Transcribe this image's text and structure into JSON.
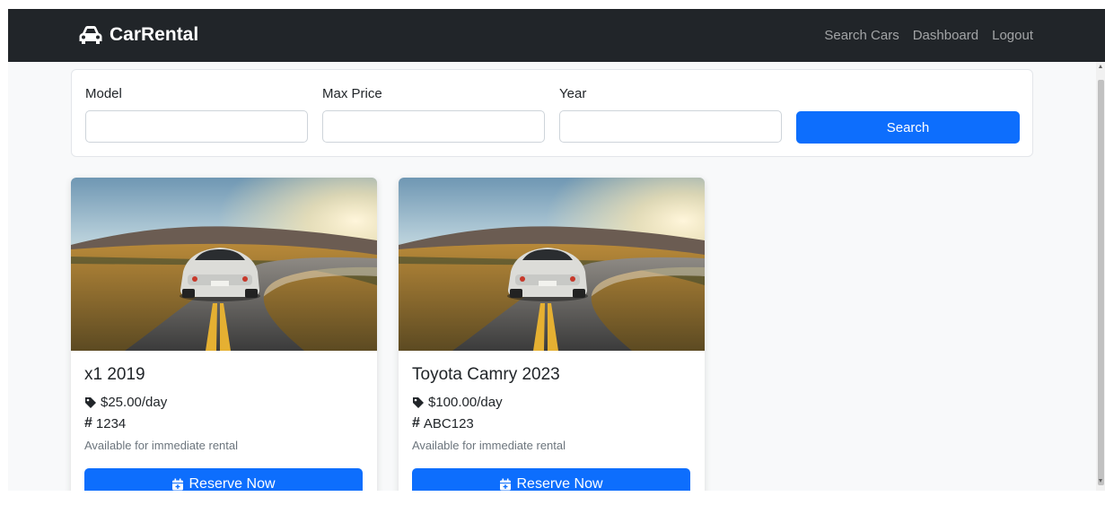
{
  "nav": {
    "brand": "CarRental",
    "links": [
      "Search Cars",
      "Dashboard",
      "Logout"
    ]
  },
  "search": {
    "fields": [
      {
        "label": "Model",
        "value": "",
        "placeholder": ""
      },
      {
        "label": "Max Price",
        "value": "",
        "placeholder": ""
      },
      {
        "label": "Year",
        "value": "",
        "placeholder": ""
      }
    ],
    "button": "Search"
  },
  "cars": [
    {
      "title": "x1 2019",
      "price": "$25.00/day",
      "plate": "1234",
      "availability": "Available for immediate rental",
      "button": "Reserve Now"
    },
    {
      "title": "Toyota Camry 2023",
      "price": "$100.00/day",
      "plate": "ABC123",
      "availability": "Available for immediate rental",
      "button": "Reserve Now"
    }
  ],
  "colors": {
    "navbar": "#212529",
    "primary": "#0d6efd",
    "page": "#f8f9fa",
    "muted": "#6c757d"
  },
  "icons": {
    "brand": "car-icon",
    "price": "tag-icon",
    "plate": "hash-icon",
    "reserve": "calendar-plus-icon"
  }
}
